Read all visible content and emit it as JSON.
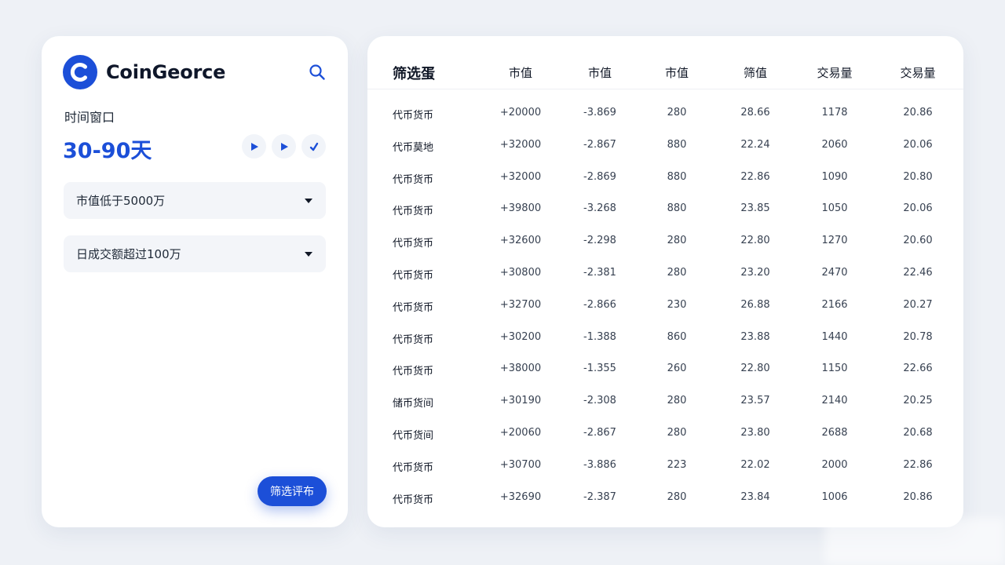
{
  "app": {
    "brand": "CoinGeorce",
    "logo_letter": "C",
    "accent_color": "#1c4fd8"
  },
  "filters": {
    "time_window_label": "时间窗口",
    "time_window_value": "30-90天",
    "play_buttons": [
      "play-icon",
      "play-icon",
      "check-icon"
    ],
    "market_cap": "市值低于5000万",
    "daily_volume": "日成交额超过100万",
    "submit_label": "筛选评布"
  },
  "table": {
    "columns": [
      "筛选蛋",
      "市值",
      "市值",
      "市值",
      "筛值",
      "交易量",
      "交易量"
    ],
    "rows": [
      [
        "代币货币",
        "+20000",
        "-3.869",
        "280",
        "28.66",
        "1178",
        "20.86"
      ],
      [
        "代币莫地",
        "+32000",
        "-2.867",
        "880",
        "22.24",
        "2060",
        "20.06"
      ],
      [
        "代币货币",
        "+32000",
        "-2.869",
        "880",
        "22.86",
        "1090",
        "20.80"
      ],
      [
        "代币货币",
        "+39800",
        "-3.268",
        "880",
        "23.85",
        "1050",
        "20.06"
      ],
      [
        "代币货币",
        "+32600",
        "-2.298",
        "280",
        "22.80",
        "1270",
        "20.60"
      ],
      [
        "代币货币",
        "+30800",
        "-2.381",
        "280",
        "23.20",
        "2470",
        "22.46"
      ],
      [
        "代币货币",
        "+32700",
        "-2.866",
        "230",
        "26.88",
        "2166",
        "20.27"
      ],
      [
        "代币货币",
        "+30200",
        "-1.388",
        "860",
        "23.88",
        "1440",
        "20.78"
      ],
      [
        "代币货币",
        "+38000",
        "-1.355",
        "260",
        "22.80",
        "1150",
        "22.66"
      ],
      [
        "储币货间",
        "+30190",
        "-2.308",
        "280",
        "23.57",
        "2140",
        "20.25"
      ],
      [
        "代币货间",
        "+20060",
        "-2.867",
        "280",
        "23.80",
        "2688",
        "20.68"
      ],
      [
        "代币货币",
        "+30700",
        "-3.886",
        "223",
        "22.02",
        "2000",
        "22.86"
      ],
      [
        "代币货币",
        "+32690",
        "-2.387",
        "280",
        "23.84",
        "1006",
        "20.86"
      ]
    ]
  }
}
